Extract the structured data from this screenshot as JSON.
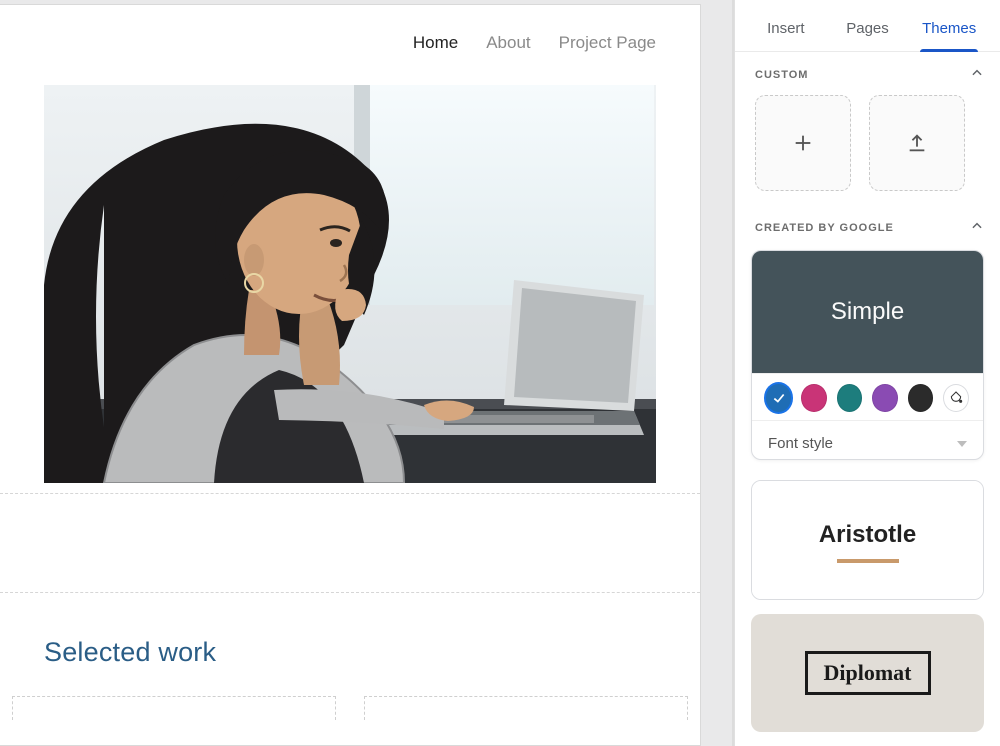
{
  "nav": {
    "items": [
      {
        "label": "Home",
        "active": true
      },
      {
        "label": "About",
        "active": false
      },
      {
        "label": "Project Page",
        "active": false
      }
    ]
  },
  "section": {
    "selected_work": "Selected work"
  },
  "sidebar": {
    "tabs": [
      {
        "label": "Insert",
        "active": false
      },
      {
        "label": "Pages",
        "active": false
      },
      {
        "label": "Themes",
        "active": true
      }
    ],
    "sections": {
      "custom": "CUSTOM",
      "google": "CREATED BY GOOGLE"
    },
    "themes": {
      "simple": {
        "label": "Simple"
      },
      "aristotle": {
        "label": "Aristotle"
      },
      "diplomat": {
        "label": "Diplomat"
      }
    },
    "swatches": [
      {
        "color": "#1f6db5",
        "selected": true
      },
      {
        "color": "#c93477",
        "selected": false
      },
      {
        "color": "#1d7d7d",
        "selected": false
      },
      {
        "color": "#8a4bb3",
        "selected": false
      },
      {
        "color": "#2b2b2b",
        "selected": false
      }
    ],
    "font_style_label": "Font style"
  }
}
